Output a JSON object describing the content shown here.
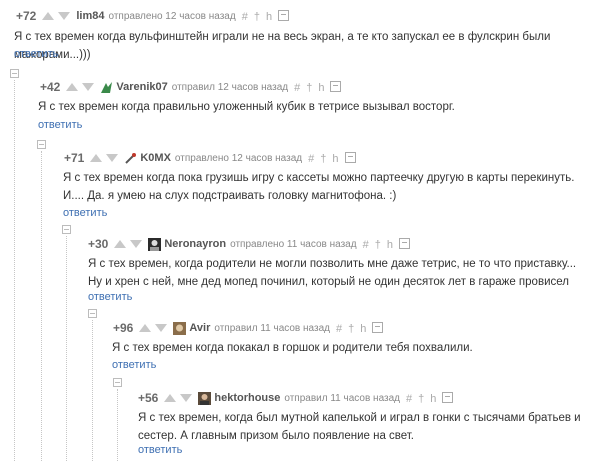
{
  "comments": [
    {
      "rating": "+72",
      "author": "lim84",
      "meta": "отправлено 12 часов назад",
      "text": "Я с тех времен когда вульфинштейн играли не на весь экран, а те кто запускал ее в фулскрин были мажорами...)))",
      "reply": "ответить"
    },
    {
      "rating": "+42",
      "author": "Varenik07",
      "meta": "отправил 12 часов назад",
      "text": "Я с тех времен когда правильно уложенный кубик в тетрисе вызывал восторг.",
      "reply": "ответить"
    },
    {
      "rating": "+71",
      "author": "K0MX",
      "meta": "отправлено 12 часов назад",
      "text": "Я с тех времен когда пока грузишь игру с кассеты можно партеечку другую в карты перекинуть. И.... Да. я умею на слух подстраивать головку магнитофона. :)",
      "reply": "ответить"
    },
    {
      "rating": "+30",
      "author": "Neronayron",
      "meta": "отправлено 11 часов назад",
      "text": "Я с тех времен, когда родители не могли позволить мне даже тетрис, не то что приставку... Ну и хрен с ней, мне дед мопед починил, который не один десяток лет в гараже провисел",
      "reply": "ответить"
    },
    {
      "rating": "+96",
      "author": "Avir",
      "meta": "отправил 11 часов назад",
      "text": "Я с тех времен когда покакал в горшок и родители тебя похвалили.",
      "reply": "ответить"
    },
    {
      "rating": "+56",
      "author": "hektorhouse",
      "meta": "отправил 11 часов назад",
      "text": "Я с тех времен, когда был мутной капелькой и играл в гонки с тысячами братьев и сестер. А главным призом было появление на свет.",
      "reply": "ответить"
    }
  ],
  "tool_icons": [
    "hash-icon",
    "pin-icon",
    "tree-icon",
    "save-icon"
  ],
  "tool_glyphs": [
    "#",
    "†",
    "h"
  ],
  "colors": {
    "link": "#3e6fb2",
    "rating": "#6a6a6a",
    "meta": "#888888",
    "text": "#333333"
  }
}
